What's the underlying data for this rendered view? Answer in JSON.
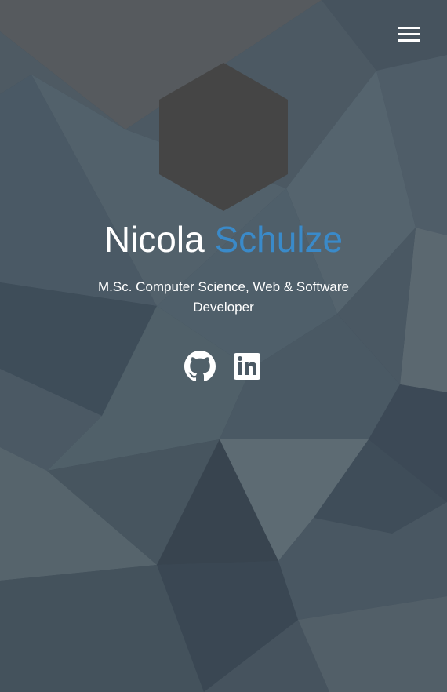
{
  "header": {
    "menu_icon": "hamburger-menu-icon"
  },
  "profile": {
    "avatar_shape": "hexagon",
    "first_name": "Nicola",
    "last_name": "Schulze",
    "subtitle": "M.Sc. Computer Science, Web & Software Developer"
  },
  "social": {
    "links": [
      {
        "icon": "github-icon"
      },
      {
        "icon": "linkedin-icon"
      }
    ]
  },
  "colors": {
    "background": "#3e4c58",
    "accent": "#3a8ac9",
    "avatar": "#454545",
    "text": "#ffffff"
  }
}
